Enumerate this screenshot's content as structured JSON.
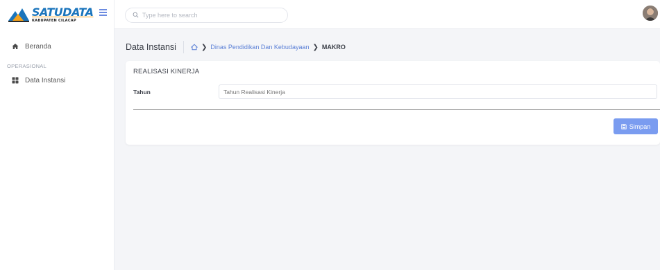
{
  "brand": {
    "logo_main": "SATUDATA",
    "logo_sub": "KABUPATEN CILACAP"
  },
  "search": {
    "placeholder": "Type here to search"
  },
  "sidebar": {
    "items": [
      {
        "label": "Beranda",
        "icon": "home-icon"
      }
    ],
    "section_label": "OPERASIONAL",
    "section_items": [
      {
        "label": "Data Instansi",
        "icon": "grid-icon"
      }
    ]
  },
  "breadcrumb": {
    "title": "Data Instansi",
    "link": "Dinas Pendidikan Dan Kebudayaan",
    "current": "MAKRO"
  },
  "card": {
    "title": "REALISASI KINERJA",
    "field_label": "Tahun",
    "field_placeholder": "Tahun Realisasi Kinerja",
    "save_label": "Simpan"
  },
  "colors": {
    "accent": "#7a9cf0",
    "link": "#5a7fd6",
    "logo_blue": "#1b75bc",
    "logo_orange": "#f6a21c"
  }
}
